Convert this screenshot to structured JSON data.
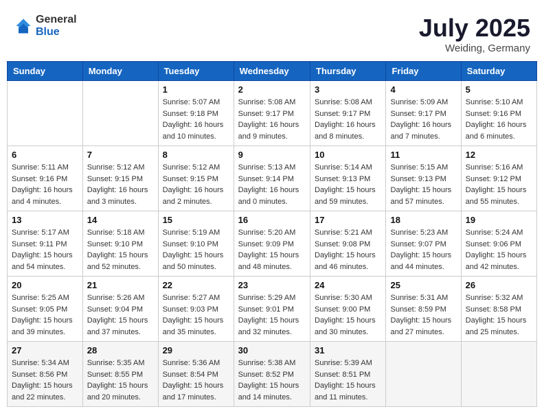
{
  "logo": {
    "general": "General",
    "blue": "Blue"
  },
  "title": {
    "month_year": "July 2025",
    "location": "Weiding, Germany"
  },
  "weekdays": [
    "Sunday",
    "Monday",
    "Tuesday",
    "Wednesday",
    "Thursday",
    "Friday",
    "Saturday"
  ],
  "weeks": [
    [
      {
        "day": "",
        "info": ""
      },
      {
        "day": "",
        "info": ""
      },
      {
        "day": "1",
        "info": "Sunrise: 5:07 AM\nSunset: 9:18 PM\nDaylight: 16 hours and 10 minutes."
      },
      {
        "day": "2",
        "info": "Sunrise: 5:08 AM\nSunset: 9:17 PM\nDaylight: 16 hours and 9 minutes."
      },
      {
        "day": "3",
        "info": "Sunrise: 5:08 AM\nSunset: 9:17 PM\nDaylight: 16 hours and 8 minutes."
      },
      {
        "day": "4",
        "info": "Sunrise: 5:09 AM\nSunset: 9:17 PM\nDaylight: 16 hours and 7 minutes."
      },
      {
        "day": "5",
        "info": "Sunrise: 5:10 AM\nSunset: 9:16 PM\nDaylight: 16 hours and 6 minutes."
      }
    ],
    [
      {
        "day": "6",
        "info": "Sunrise: 5:11 AM\nSunset: 9:16 PM\nDaylight: 16 hours and 4 minutes."
      },
      {
        "day": "7",
        "info": "Sunrise: 5:12 AM\nSunset: 9:15 PM\nDaylight: 16 hours and 3 minutes."
      },
      {
        "day": "8",
        "info": "Sunrise: 5:12 AM\nSunset: 9:15 PM\nDaylight: 16 hours and 2 minutes."
      },
      {
        "day": "9",
        "info": "Sunrise: 5:13 AM\nSunset: 9:14 PM\nDaylight: 16 hours and 0 minutes."
      },
      {
        "day": "10",
        "info": "Sunrise: 5:14 AM\nSunset: 9:13 PM\nDaylight: 15 hours and 59 minutes."
      },
      {
        "day": "11",
        "info": "Sunrise: 5:15 AM\nSunset: 9:13 PM\nDaylight: 15 hours and 57 minutes."
      },
      {
        "day": "12",
        "info": "Sunrise: 5:16 AM\nSunset: 9:12 PM\nDaylight: 15 hours and 55 minutes."
      }
    ],
    [
      {
        "day": "13",
        "info": "Sunrise: 5:17 AM\nSunset: 9:11 PM\nDaylight: 15 hours and 54 minutes."
      },
      {
        "day": "14",
        "info": "Sunrise: 5:18 AM\nSunset: 9:10 PM\nDaylight: 15 hours and 52 minutes."
      },
      {
        "day": "15",
        "info": "Sunrise: 5:19 AM\nSunset: 9:10 PM\nDaylight: 15 hours and 50 minutes."
      },
      {
        "day": "16",
        "info": "Sunrise: 5:20 AM\nSunset: 9:09 PM\nDaylight: 15 hours and 48 minutes."
      },
      {
        "day": "17",
        "info": "Sunrise: 5:21 AM\nSunset: 9:08 PM\nDaylight: 15 hours and 46 minutes."
      },
      {
        "day": "18",
        "info": "Sunrise: 5:23 AM\nSunset: 9:07 PM\nDaylight: 15 hours and 44 minutes."
      },
      {
        "day": "19",
        "info": "Sunrise: 5:24 AM\nSunset: 9:06 PM\nDaylight: 15 hours and 42 minutes."
      }
    ],
    [
      {
        "day": "20",
        "info": "Sunrise: 5:25 AM\nSunset: 9:05 PM\nDaylight: 15 hours and 39 minutes."
      },
      {
        "day": "21",
        "info": "Sunrise: 5:26 AM\nSunset: 9:04 PM\nDaylight: 15 hours and 37 minutes."
      },
      {
        "day": "22",
        "info": "Sunrise: 5:27 AM\nSunset: 9:03 PM\nDaylight: 15 hours and 35 minutes."
      },
      {
        "day": "23",
        "info": "Sunrise: 5:29 AM\nSunset: 9:01 PM\nDaylight: 15 hours and 32 minutes."
      },
      {
        "day": "24",
        "info": "Sunrise: 5:30 AM\nSunset: 9:00 PM\nDaylight: 15 hours and 30 minutes."
      },
      {
        "day": "25",
        "info": "Sunrise: 5:31 AM\nSunset: 8:59 PM\nDaylight: 15 hours and 27 minutes."
      },
      {
        "day": "26",
        "info": "Sunrise: 5:32 AM\nSunset: 8:58 PM\nDaylight: 15 hours and 25 minutes."
      }
    ],
    [
      {
        "day": "27",
        "info": "Sunrise: 5:34 AM\nSunset: 8:56 PM\nDaylight: 15 hours and 22 minutes."
      },
      {
        "day": "28",
        "info": "Sunrise: 5:35 AM\nSunset: 8:55 PM\nDaylight: 15 hours and 20 minutes."
      },
      {
        "day": "29",
        "info": "Sunrise: 5:36 AM\nSunset: 8:54 PM\nDaylight: 15 hours and 17 minutes."
      },
      {
        "day": "30",
        "info": "Sunrise: 5:38 AM\nSunset: 8:52 PM\nDaylight: 15 hours and 14 minutes."
      },
      {
        "day": "31",
        "info": "Sunrise: 5:39 AM\nSunset: 8:51 PM\nDaylight: 15 hours and 11 minutes."
      },
      {
        "day": "",
        "info": ""
      },
      {
        "day": "",
        "info": ""
      }
    ]
  ]
}
